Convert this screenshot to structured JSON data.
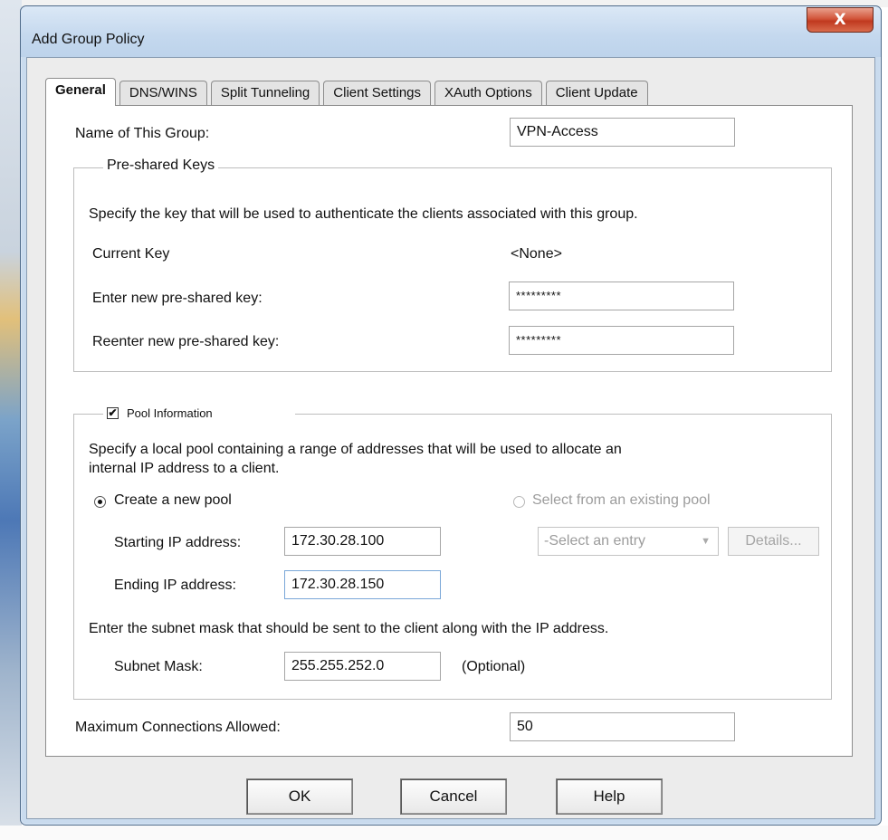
{
  "window": {
    "title": "Add Group Policy",
    "close_glyph": "X"
  },
  "tabs": [
    {
      "label": "General",
      "active": true
    },
    {
      "label": "DNS/WINS",
      "active": false
    },
    {
      "label": "Split Tunneling",
      "active": false
    },
    {
      "label": "Client Settings",
      "active": false
    },
    {
      "label": "XAuth Options",
      "active": false
    },
    {
      "label": "Client Update",
      "active": false
    }
  ],
  "general": {
    "group_name_label": "Name of This Group:",
    "group_name_value": "VPN-Access",
    "psk": {
      "legend": "Pre-shared Keys",
      "description": "Specify the key that will be used to authenticate the clients associated with this group.",
      "current_key_label": "Current Key",
      "current_key_value": "<None>",
      "new_key_label": "Enter new pre-shared key:",
      "new_key_value": "*********",
      "reenter_key_label": "Reenter new pre-shared key:",
      "reenter_key_value": "*********"
    },
    "pool": {
      "legend": "Pool Information",
      "checked": true,
      "check_glyph": "✔",
      "description_line1": "Specify a local pool containing a range of addresses that will be used to allocate an",
      "description_line2": "internal IP address to a client.",
      "create_new_label": "Create a new pool",
      "select_existing_label": "Select from an existing pool",
      "starting_ip_label": "Starting IP address:",
      "starting_ip_value": "172.30.28.100",
      "ending_ip_label": "Ending IP address:",
      "ending_ip_value": "172.30.28.150",
      "select_entry_placeholder": "-Select an entry",
      "select_arrow_glyph": "▼",
      "details_label": "Details...",
      "subnet_description": "Enter the subnet mask that should be sent to the client along with the IP address.",
      "subnet_label": "Subnet Mask:",
      "subnet_value": "255.255.252.0",
      "subnet_optional": "(Optional)"
    },
    "max_conn_label": "Maximum Connections Allowed:",
    "max_conn_value": "50"
  },
  "buttons": {
    "ok": "OK",
    "cancel": "Cancel",
    "help": "Help"
  }
}
